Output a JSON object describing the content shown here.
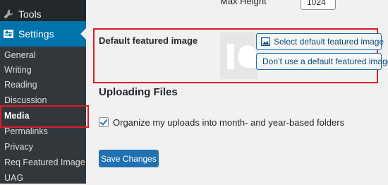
{
  "sidebar": {
    "tools_label": "Tools",
    "settings_label": "Settings",
    "submenu": [
      "General",
      "Writing",
      "Reading",
      "Discussion",
      "Media",
      "Permalinks",
      "Privacy",
      "Req Featured Image",
      "UAG"
    ],
    "active_item": "Media"
  },
  "main": {
    "max_height_label": "Max Height",
    "max_height_value": "1024",
    "featured": {
      "label": "Default featured image",
      "select_button": "Select default featured image",
      "dont_use_button": "Don’t use a default featured image"
    },
    "uploading": {
      "heading": "Uploading Files",
      "organize_label": "Organize my uploads into month- and year-based folders",
      "organize_checked": true
    },
    "save_button": "Save Changes"
  },
  "colors": {
    "sidebar_bg": "#23282d",
    "submenu_bg": "#32373c",
    "accent": "#0073aa",
    "button_blue": "#2271b1",
    "highlight_red": "#e01b24"
  }
}
